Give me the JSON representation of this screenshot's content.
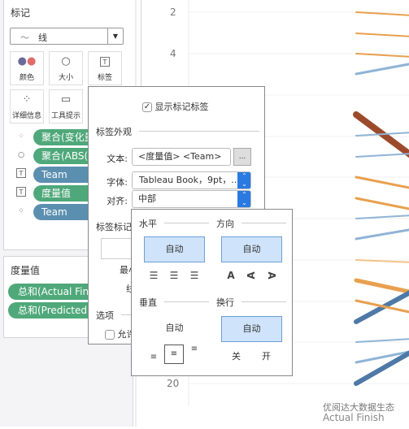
{
  "marks_card": {
    "title": "标记",
    "mark_type": "线",
    "mark_type_icon": "line-chart-icon",
    "buttons": [
      {
        "label": "颜色",
        "icon": "color-dots-icon"
      },
      {
        "label": "大小",
        "icon": "size-icon"
      },
      {
        "label": "标签",
        "icon": "label-text-icon"
      },
      {
        "label": "详细信息",
        "icon": "detail-dots-icon"
      },
      {
        "label": "工具提示",
        "icon": "tooltip-icon"
      }
    ],
    "pills": [
      {
        "icon": "color-dots-icon",
        "label": "聚合(变化量",
        "color": "green"
      },
      {
        "icon": "size-icon",
        "label": "聚合(ABS([",
        "color": "green"
      },
      {
        "icon": "label-text-icon",
        "label": "Team",
        "color": "blue"
      },
      {
        "icon": "label-text-icon",
        "label": "度量值",
        "color": "green"
      },
      {
        "icon": "detail-dots-icon",
        "label": "Team",
        "color": "blue"
      }
    ]
  },
  "measures_card": {
    "title": "度量值",
    "pills": [
      "总和(Actual Finis",
      "总和(Predicted F"
    ]
  },
  "label_dialog": {
    "show_labels": "显示标记标签",
    "show_labels_checked": true,
    "appearance_title": "标签外观",
    "text_label": "文本:",
    "text_value": "<度量值> <Team>",
    "text_button": "...",
    "font_label": "字体:",
    "font_value": "Tableau Book，9pt，..",
    "align_label": "对齐:",
    "align_value": "中部",
    "marks_label_title": "标签标记",
    "min_label": "最小",
    "line_label": "线",
    "options_title": "选项",
    "allow_label": "允许",
    "allow_checked": false
  },
  "align_popup": {
    "horizontal_title": "水平",
    "horizontal_value": "自动",
    "direction_title": "方向",
    "direction_value": "自动",
    "vertical_title": "垂直",
    "vertical_value": "自动",
    "wrap_title": "换行",
    "wrap_value": "自动",
    "wrap_off": "关",
    "wrap_on": "开"
  },
  "chart": {
    "y_ticks": [
      "2",
      "4",
      "20"
    ],
    "x_label": "Actual Finish",
    "colors": {
      "orange": "#e8a04f",
      "light_orange": "#f2c48c",
      "blue": "#4e79a7",
      "light_blue": "#8fb4d6",
      "brown": "#9c4a2c"
    }
  },
  "watermark": "优阅达大数据生态"
}
